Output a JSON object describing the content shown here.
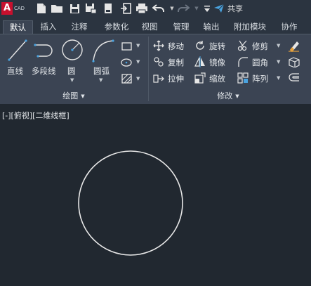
{
  "app": {
    "logo_letter": "A",
    "logo_text": "CAD"
  },
  "quick_access": {
    "share_label": "共享",
    "icons": [
      "new-icon",
      "open-icon",
      "save-icon",
      "save-as-icon",
      "plot-preview-icon",
      "import-icon",
      "print-icon",
      "undo-icon",
      "redo-icon",
      "dropdown-icon",
      "share-icon"
    ]
  },
  "tabs": [
    {
      "label": "默认",
      "active": true
    },
    {
      "label": "插入"
    },
    {
      "label": "注释"
    },
    {
      "label": "参数化"
    },
    {
      "label": "视图"
    },
    {
      "label": "管理"
    },
    {
      "label": "输出"
    },
    {
      "label": "附加模块"
    },
    {
      "label": "协作"
    }
  ],
  "draw_panel": {
    "title": "绘图",
    "tools": [
      "直线",
      "多段线",
      "圆",
      "圆弧"
    ]
  },
  "modify_panel": {
    "title": "修改",
    "tools": [
      {
        "label": "移动"
      },
      {
        "label": "旋转"
      },
      {
        "label": "修剪"
      },
      {
        "label": "复制"
      },
      {
        "label": "镜像"
      },
      {
        "label": "圆角"
      },
      {
        "label": "拉伸"
      },
      {
        "label": "缩放"
      },
      {
        "label": "阵列"
      }
    ]
  },
  "viewport": {
    "label": "[-][俯视][二维线框]"
  },
  "colors": {
    "background": "#212830",
    "ribbon": "#3b4453",
    "toolbar": "#2b3440",
    "accent_logo": "#c8102e",
    "share_icon": "#4aa3df"
  }
}
